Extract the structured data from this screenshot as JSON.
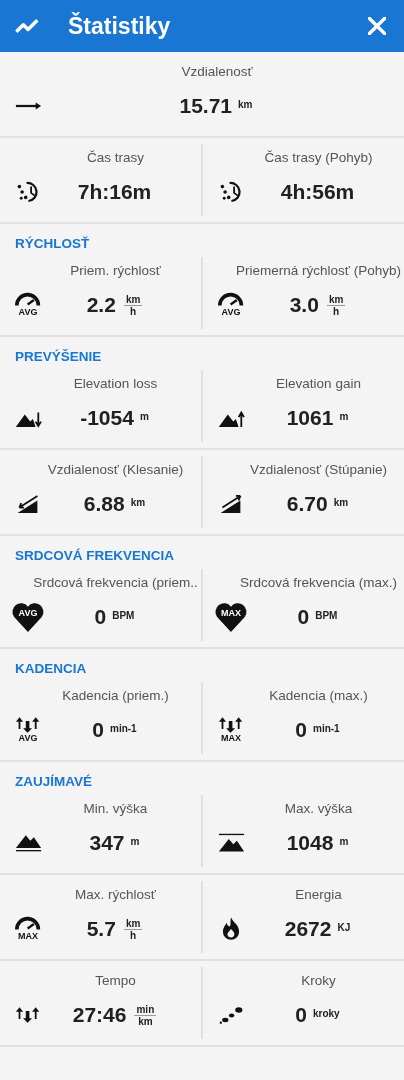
{
  "header": {
    "title": "Štatistiky"
  },
  "sections": [
    {
      "rows": [
        [
          {
            "label": "Vzdialenosť",
            "value": "15.71",
            "unit": "km"
          }
        ],
        [
          {
            "label": "Čas trasy",
            "value": "7h:16m"
          },
          {
            "label": "Čas trasy (Pohyb)",
            "value": "4h:56m"
          }
        ]
      ]
    },
    {
      "title": "RÝCHLOSŤ",
      "rows": [
        [
          {
            "label": "Priem. rýchlosť",
            "value": "2.2",
            "unit": {
              "top": "km",
              "bottom": "h"
            },
            "icon_badge": "AVG"
          },
          {
            "label": "Priemerná rýchlosť (Pohyb)",
            "value": "3.0",
            "unit": {
              "top": "km",
              "bottom": "h"
            },
            "icon_badge": "AVG"
          }
        ]
      ]
    },
    {
      "title": "PREVÝŠENIE",
      "rows": [
        [
          {
            "label": "Elevation loss",
            "value": "-1054",
            "unit": "m"
          },
          {
            "label": "Elevation gain",
            "value": "1061",
            "unit": "m"
          }
        ],
        [
          {
            "label": "Vzdialenosť (Klesanie)",
            "value": "6.88",
            "unit": "km"
          },
          {
            "label": "Vzdialenosť (Stúpanie)",
            "value": "6.70",
            "unit": "km"
          }
        ]
      ]
    },
    {
      "title": "SRDCOVÁ FREKVENCIA",
      "rows": [
        [
          {
            "label": "Srdcová frekvencia (priem..",
            "value": "0",
            "unit": "BPM",
            "icon_badge": "AVG"
          },
          {
            "label": "Srdcová frekvencia (max.)",
            "value": "0",
            "unit": "BPM",
            "icon_badge": "MAX"
          }
        ]
      ]
    },
    {
      "title": "KADENCIA",
      "rows": [
        [
          {
            "label": "Kadencia (priem.)",
            "value": "0",
            "unit": "min-1",
            "icon_badge": "AVG"
          },
          {
            "label": "Kadencia (max.)",
            "value": "0",
            "unit": "min-1",
            "icon_badge": "MAX"
          }
        ]
      ]
    },
    {
      "title": "ZAUJÍMAVÉ",
      "rows": [
        [
          {
            "label": "Min. výška",
            "value": "347",
            "unit": "m"
          },
          {
            "label": "Max. výška",
            "value": "1048",
            "unit": "m"
          }
        ],
        [
          {
            "label": "Max. rýchlosť",
            "value": "5.7",
            "unit": {
              "top": "km",
              "bottom": "h"
            },
            "icon_badge": "MAX"
          },
          {
            "label": "Energia",
            "value": "2672",
            "unit": "KJ"
          }
        ],
        [
          {
            "label": "Tempo",
            "value": "27:46",
            "unit": {
              "top": "min",
              "bottom": "km"
            }
          },
          {
            "label": "Kroky",
            "value": "0",
            "unit": "kroky"
          }
        ]
      ]
    }
  ]
}
